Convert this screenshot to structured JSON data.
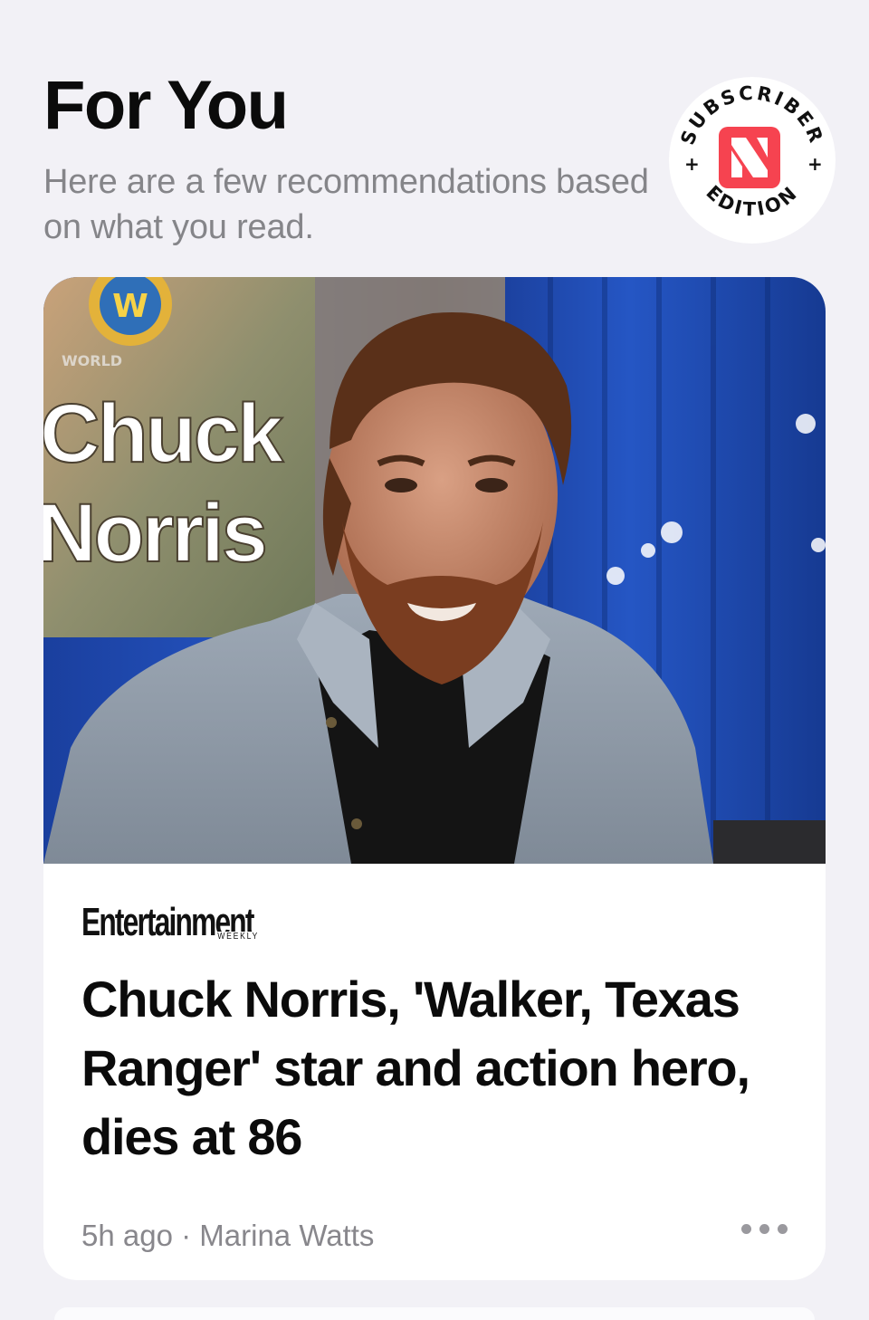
{
  "section": {
    "title": "For You",
    "subtitle": "Here are a few recommendations based on what you read."
  },
  "badge": {
    "text_top": "SUBSCRIBER",
    "text_bottom": "EDITION",
    "icon": "apple-news-icon",
    "accent": "#f64350"
  },
  "article": {
    "publisher": "Entertainment",
    "publisher_sub": "WEEKLY",
    "headline": "Chuck Norris, 'Walker, Texas Ranger' star and action hero, dies at 86",
    "time": "5h ago",
    "separator": "·",
    "author": "Marina Watts",
    "banner_text_line1": "Chuck",
    "banner_text_line2": "Norris",
    "banner_text_top": "WORLD",
    "banner_logo": "W",
    "more_icon": "more-dots-icon"
  }
}
